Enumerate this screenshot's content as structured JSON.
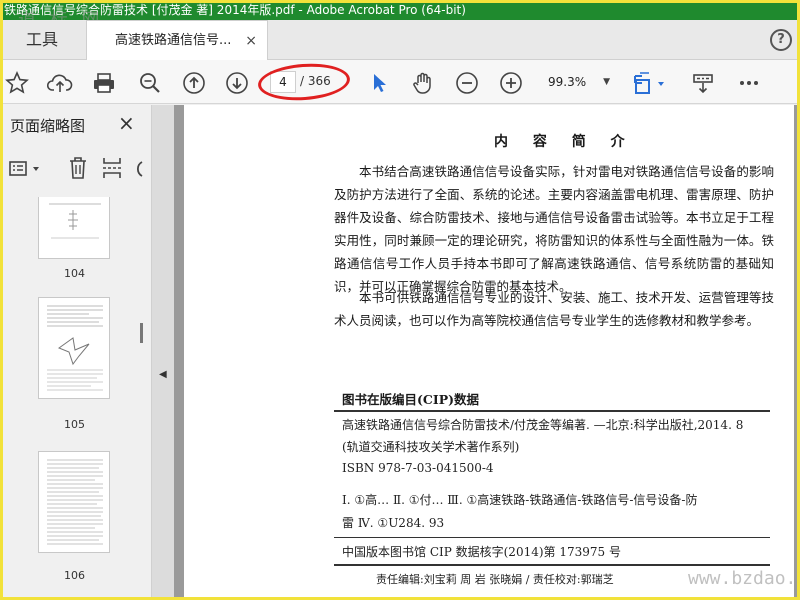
{
  "window": {
    "title": "铁路通信信号综合防雷技术 [付茂金 著] 2014年版.pdf - Adobe Acrobat Pro (64-bit)",
    "watermark": "道 标 网"
  },
  "tabs": {
    "tools_label": "工具",
    "doc_label": "高速铁路通信信号...",
    "close_glyph": "×",
    "help_glyph": "?"
  },
  "toolbar": {
    "current_page": "4",
    "page_total": "/ 366",
    "zoom": "99.3%",
    "highlight_color": "#e02020",
    "select_tool_color": "#2a6fd6"
  },
  "sidepanel": {
    "title": "页面缩略图",
    "close_glyph": "×",
    "thumbnails": [
      {
        "label": "104"
      },
      {
        "label": "105"
      },
      {
        "label": "106"
      }
    ]
  },
  "document": {
    "intro_title": "内 容 简 介",
    "paragraph1": "本书结合高速铁路通信信号设备实际，针对雷电对铁路通信信号设备的影响及防护方法进行了全面、系统的论述。主要内容涵盖雷电机理、雷害原理、防护器件及设备、综合防雷技术、接地与通信信号设备雷击试验等。本书立足于工程实用性，同时兼顾一定的理论研究，将防雷知识的体系性与全面性融为一体。铁路通信信号工作人员手持本书即可了解高速铁路通信、信号系统防雷的基础知识，并可以正确掌握综合防雷的基本技术。",
    "paragraph2": "本书可供铁路通信信号专业的设计、安装、施工、技术开发、运营管理等技术人员阅读，也可以作为高等院校通信信号专业学生的选修教材和教学参考。",
    "cip_heading": "图书在版编目(CIP)数据",
    "cip_line1": "高速铁路通信信号综合防雷技术/付茂金等编著. —北京:科学出版社,2014. 8",
    "cip_line2": "(轨道交通科技攻关学术著作系列)",
    "cip_isbn": "ISBN 978-7-03-041500-4",
    "cip_class1": "Ⅰ. ①高…   Ⅱ. ①付…   Ⅲ. ①高速铁路-铁路通信-铁路信号-信号设备-防",
    "cip_class2": "雷   Ⅳ. ①U284. 93",
    "cip_number": "中国版本图书馆 CIP 数据核字(2014)第 173975 号",
    "editors": "责任编辑:刘宝莉   周   岩   张晓娟  /  责任校对:郭瑞芝",
    "watermark": "www.bzdao.com"
  }
}
